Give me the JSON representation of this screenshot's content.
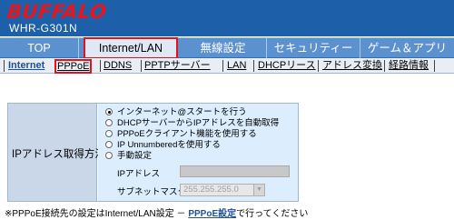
{
  "header": {
    "logo": "BUFFALO",
    "model": "WHR-G301N"
  },
  "main_tabs": [
    {
      "label": "TOP",
      "active": false
    },
    {
      "label": "Internet/LAN",
      "active": true
    },
    {
      "label": "無線設定",
      "active": false
    },
    {
      "label": "セキュリティー",
      "active": false
    },
    {
      "label": "ゲーム＆アプリ",
      "active": false
    }
  ],
  "sub_tabs": [
    {
      "label": "Internet",
      "current": true
    },
    {
      "label": "PPPoE",
      "selected": true
    },
    {
      "label": "DDNS"
    },
    {
      "label": "PPTPサーバー"
    },
    {
      "label": "LAN"
    },
    {
      "label": "DHCPリース"
    },
    {
      "label": "アドレス変換"
    },
    {
      "label": "経路情報"
    }
  ],
  "form": {
    "label": "IPアドレス取得方法",
    "options": [
      {
        "label": "インターネット@スタートを行う",
        "checked": true
      },
      {
        "label": "DHCPサーバーからIPアドレスを自動取得",
        "checked": false
      },
      {
        "label": "PPPoEクライアント機能を使用する",
        "checked": false
      },
      {
        "label": "IP Unnumberedを使用する",
        "checked": false
      },
      {
        "label": "手動設定",
        "checked": false
      }
    ],
    "ip_label": "IPアドレス",
    "ip_value": "",
    "mask_label": "サブネットマスク",
    "mask_value": "255.255.255.0"
  },
  "note": {
    "prefix": "※PPPoE接続先の設定はInternet/LAN設定 － ",
    "link": "PPPoE設定",
    "suffix": "で行ってください"
  },
  "colors": {
    "header_bg": "#1d5fa8",
    "logo_red": "#e8161b",
    "tab_bar": "#5b91cf",
    "highlight_red": "#e0141a",
    "label_cell": "#c9d7e9",
    "value_cell": "#dceefd"
  }
}
